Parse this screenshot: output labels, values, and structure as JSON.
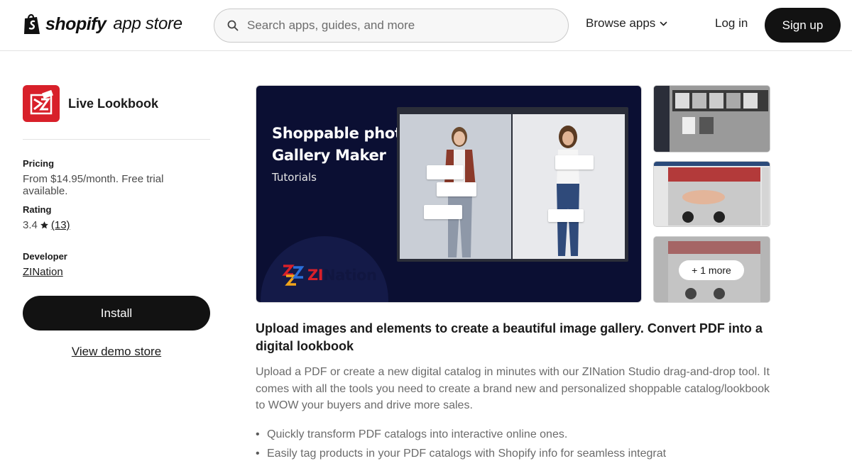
{
  "header": {
    "logo_brand": "shopify",
    "logo_product": "app store",
    "search_placeholder": "Search apps, guides, and more",
    "browse_label": "Browse apps",
    "login_label": "Log in",
    "signup_label": "Sign up"
  },
  "app": {
    "name": "Live Lookbook",
    "pricing_label": "Pricing",
    "pricing_value": "From $14.95/month. Free trial available.",
    "rating_label": "Rating",
    "rating_value": "3.4",
    "rating_count": "(13)",
    "developer_label": "Developer",
    "developer_name": "ZINation",
    "install_label": "Install",
    "demo_label": "View demo store"
  },
  "media": {
    "hero_title_line1": "Shoppable photo",
    "hero_title_line2": "Gallery Maker",
    "hero_subtitle": "Tutorials",
    "hero_brand_prefix": "ZI",
    "hero_brand_suffix": "Nation",
    "more_label": "+ 1 more"
  },
  "description": {
    "headline": "Upload images and elements to create a beautiful image gallery. Convert PDF into a digital lookbook",
    "body": "Upload a PDF or create a new digital catalog in minutes with our ZINation Studio drag-and-drop tool. It comes with all the tools you need to create a brand new and personalized shoppable catalog/lookbook to WOW your buyers and drive more sales.",
    "bullets": [
      "Quickly transform PDF catalogs into interactive online ones.",
      "Easily tag products in your PDF catalogs with Shopify info for seamless integrat"
    ]
  },
  "colors": {
    "primary_button": "#121212",
    "hero_background": "#0b0f33",
    "brand_red": "#d8202a"
  },
  "icons": [
    "shopify-bag-icon",
    "search-icon",
    "chevron-down-icon",
    "star-icon",
    "app-logo-icon",
    "zination-logo-icon"
  ]
}
